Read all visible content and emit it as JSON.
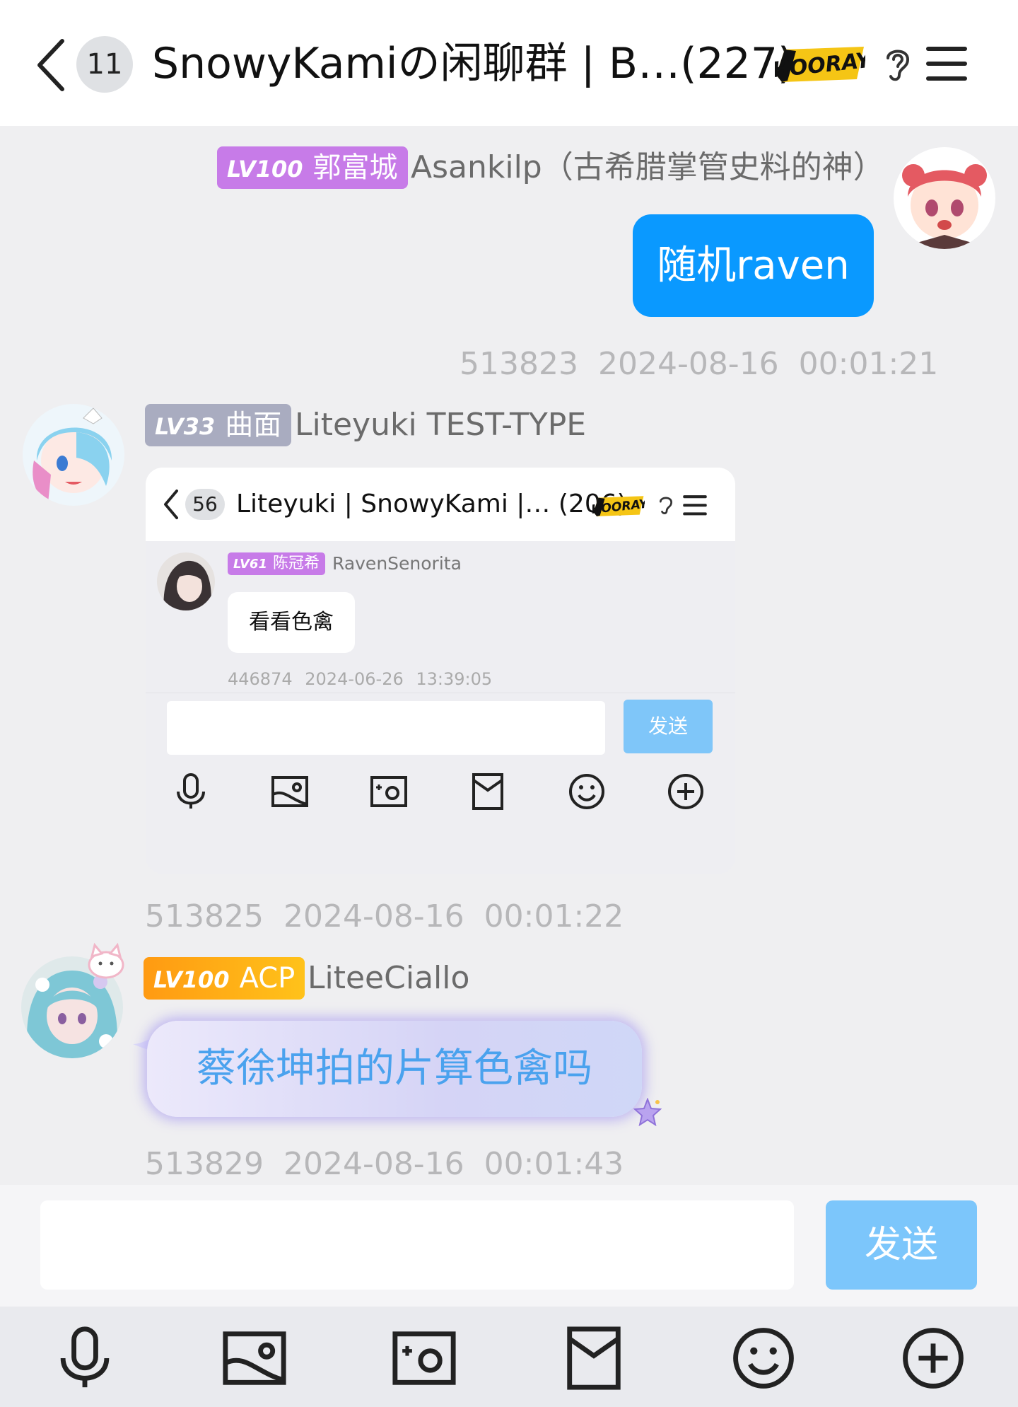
{
  "header": {
    "unread_count": "11",
    "title": "SnowyKamiの闲聊群 | B…(227)",
    "badge_text": "HOORAY"
  },
  "messages": [
    {
      "side": "right",
      "level": "LV100",
      "title_tag": "郭富城",
      "nickname": "Asankilp（古希腊掌管史料的神）",
      "text": "随机raven",
      "msg_id": "513823",
      "time": "2024-08-16 00:01:21"
    },
    {
      "side": "left",
      "level": "LV33",
      "title_tag": "曲面",
      "nickname": "Liteyuki TEST-TYPE",
      "msg_id": "513825",
      "time": "2024-08-16 00:01:22",
      "image": {
        "unread_count": "56",
        "title": "Liteyuki | SnowyKami |… (206)",
        "badge_text": "HOORAY",
        "level": "LV61",
        "title_tag": "陈冠希",
        "nickname": "RavenSenorita",
        "text": "看看色禽",
        "msg_id": "446874",
        "time": "2024-06-26 13:39:05",
        "send_label": "发送"
      }
    },
    {
      "side": "left",
      "level": "LV100",
      "title_tag": "ACP",
      "nickname": "LiteeCiallo",
      "text": "蔡徐坤拍的片算色禽吗",
      "msg_id": "513829",
      "time": "2024-08-16 00:01:43"
    }
  ],
  "composer": {
    "input_value": "",
    "send_label": "发送"
  },
  "toolbar": [
    "mic-icon",
    "picture-icon",
    "camera-icon",
    "red-packet-icon",
    "emoji-icon",
    "plus-icon"
  ],
  "colors": {
    "accent": "#0a99ff",
    "lv_purple": "#c77be8",
    "lv_gray": "#a9acc0",
    "lv_orange": "#ffa21a"
  }
}
